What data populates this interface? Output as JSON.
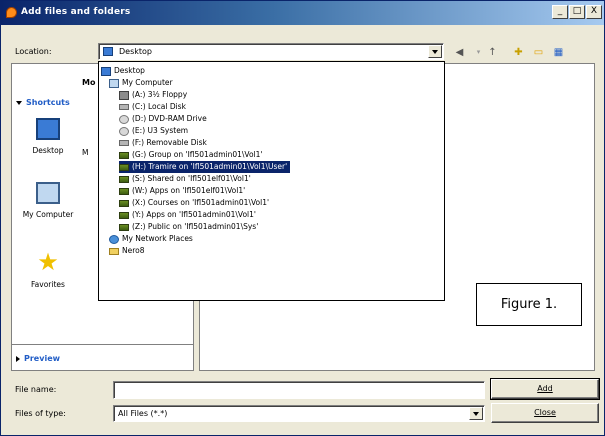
{
  "window": {
    "title": "Add files and folders",
    "controls": [
      "_",
      "□",
      "X"
    ]
  },
  "location": {
    "label": "Location:",
    "value": "Desktop"
  },
  "toolbar": {
    "icons": [
      "back-icon",
      "up-folder-icon",
      "new-folder-icon",
      "views-icon"
    ]
  },
  "sidebar": {
    "partial_text": "Mo",
    "shortcuts_label": "Shortcuts",
    "items": [
      {
        "label": "Desktop",
        "icon": "desktop-icon"
      },
      {
        "label": "M",
        "icon": "documents-icon"
      },
      {
        "label": "My Computer",
        "icon": "computer-icon"
      },
      {
        "label": "Favorites",
        "icon": "star-icon"
      }
    ],
    "preview_label": "Preview"
  },
  "dropdown": {
    "items": [
      {
        "label": "Desktop",
        "icon": "desktop"
      },
      {
        "label": "My Computer",
        "icon": "computer"
      },
      {
        "label": "(A:) 3½ Floppy",
        "icon": "floppy"
      },
      {
        "label": "(C:) Local Disk",
        "icon": "disk"
      },
      {
        "label": "(D:) DVD-RAM Drive",
        "icon": "cd"
      },
      {
        "label": "(E:) U3 System",
        "icon": "cd"
      },
      {
        "label": "(F:) Removable Disk",
        "icon": "disk"
      },
      {
        "label": "(G:) Group on 'Ifl501admin01\\Vol1'",
        "icon": "net"
      },
      {
        "label": "(H:) Tramire on 'Ifl501admin01\\Vol1\\User'",
        "icon": "net",
        "selected": true
      },
      {
        "label": "(S:) Shared on 'Ifl501elf01\\Vol1'",
        "icon": "net"
      },
      {
        "label": "(W:) Apps on 'Ifl501elf01\\Vol1'",
        "icon": "net"
      },
      {
        "label": "(X:) Courses on 'Ifl501admin01\\Vol1'",
        "icon": "net"
      },
      {
        "label": "(Y:) Apps on 'Ifl501admin01\\Vol1'",
        "icon": "net"
      },
      {
        "label": "(Z:) Public on 'Ifl501admin01\\Sys'",
        "icon": "net"
      },
      {
        "label": "My Network Places",
        "icon": "places"
      },
      {
        "label": "Nero8",
        "icon": "folder"
      }
    ]
  },
  "annotation": {
    "text": "Figure 1."
  },
  "filename": {
    "label": "File name:",
    "value": "",
    "button": "Add"
  },
  "filetype": {
    "label": "Files of type:",
    "value": "All Files (*.*)",
    "button": "Close"
  }
}
